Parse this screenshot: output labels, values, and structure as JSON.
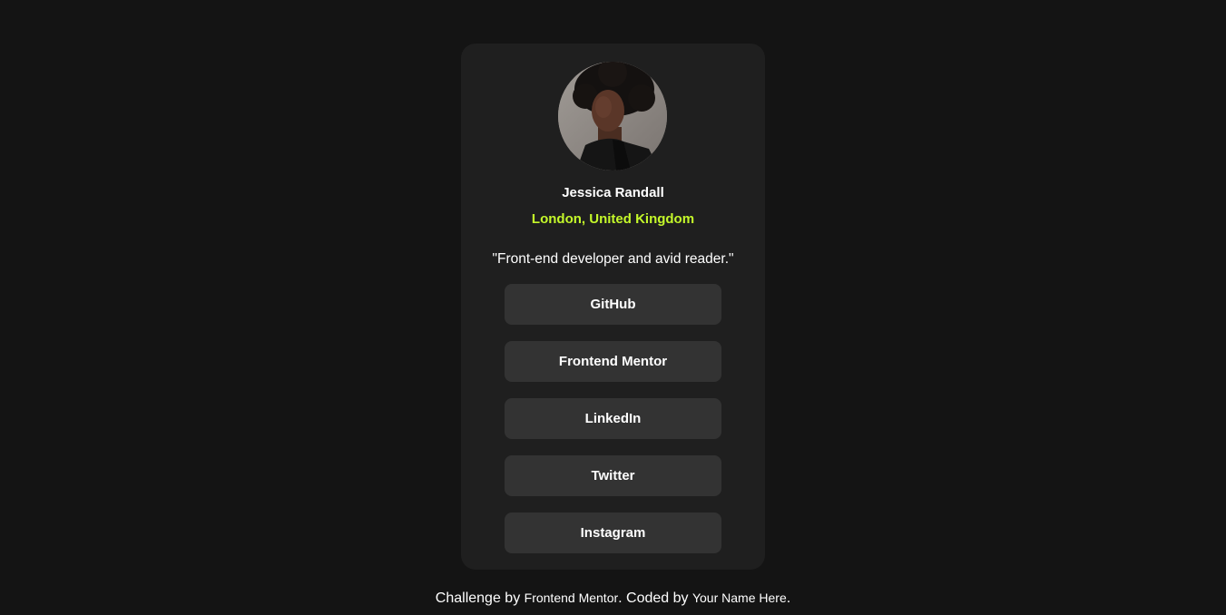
{
  "profile": {
    "name": "Jessica Randall",
    "location": "London, United Kingdom",
    "bio": "\"Front-end developer and avid reader.\""
  },
  "links": [
    {
      "label": "GitHub"
    },
    {
      "label": "Frontend Mentor"
    },
    {
      "label": "LinkedIn"
    },
    {
      "label": "Twitter"
    },
    {
      "label": "Instagram"
    }
  ],
  "attribution": {
    "prefix": "Challenge by ",
    "challenge_link": "Frontend Mentor",
    "middle": ". Coded by ",
    "author_link": "Your Name Here",
    "suffix": "."
  },
  "colors": {
    "background": "#141414",
    "card": "#1f1f1f",
    "button": "#333333",
    "accent": "#c4f82a",
    "text": "#ffffff"
  }
}
